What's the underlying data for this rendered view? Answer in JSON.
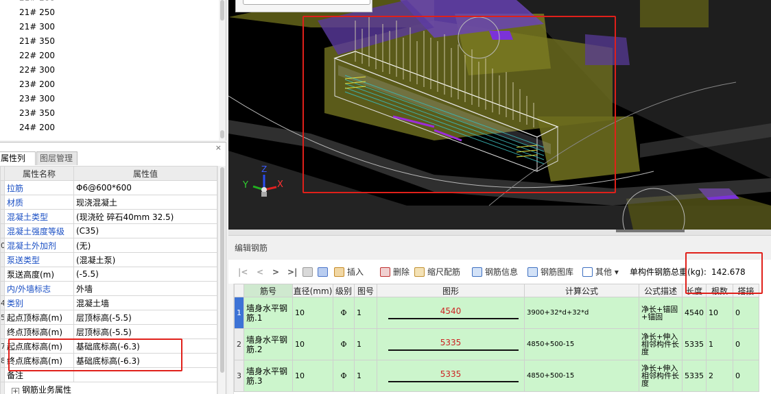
{
  "tree": {
    "items": [
      "21# 250",
      "21# 300",
      "21# 350",
      "22# 200",
      "22# 300",
      "23# 200",
      "23# 300",
      "23# 350",
      "24# 200"
    ]
  },
  "props": {
    "close": "×",
    "tabs": [
      "属性列表",
      "图层管理"
    ],
    "columns": {
      "name": "属性名称",
      "value": "属性值"
    },
    "rows": [
      {
        "num": "",
        "name": "拉筋",
        "value": "Φ6@600*600",
        "blue": true
      },
      {
        "num": "",
        "name": "材质",
        "value": "现浇混凝土",
        "blue": true
      },
      {
        "num": "",
        "name": "混凝土类型",
        "value": "(现浇砼 碎石40mm 32.5)",
        "blue": true
      },
      {
        "num": "",
        "name": "混凝土强度等级",
        "value": "(C35)",
        "blue": true
      },
      {
        "num": "0",
        "name": "混凝土外加剂",
        "value": "(无)",
        "blue": true
      },
      {
        "num": "",
        "name": "泵送类型",
        "value": "(混凝土泵)",
        "blue": true
      },
      {
        "num": "",
        "name": "泵送高度(m)",
        "value": "(-5.5)",
        "blue": false
      },
      {
        "num": "",
        "name": "内/外墙标志",
        "value": "外墙",
        "blue": true
      },
      {
        "num": "4",
        "name": "类别",
        "value": "混凝土墙",
        "blue": true
      },
      {
        "num": "5",
        "name": "起点顶标高(m)",
        "value": "层顶标高(-5.5)",
        "blue": false
      },
      {
        "num": "",
        "name": "终点顶标高(m)",
        "value": "层顶标高(-5.5)",
        "blue": false
      },
      {
        "num": "7",
        "name": "起点底标高(m)",
        "value": "基础底标高(-6.3)",
        "blue": false
      },
      {
        "num": "8",
        "name": "终点底标高(m)",
        "value": "基础底标高(-6.3)",
        "blue": false
      },
      {
        "num": "",
        "name": "备注",
        "value": "",
        "blue": false
      }
    ],
    "group": "钢筋业务属性",
    "group_plus": "+"
  },
  "viewport": {
    "axis_x": "X",
    "axis_y": "Y",
    "axis_z": "Z",
    "colors": {
      "background": "#000000",
      "olive": "#6b6b1e",
      "purple": "#6a45b5",
      "rebar": "#d8d2b0"
    }
  },
  "editor": {
    "title": "编辑钢筋",
    "toolbar": {
      "first": "|<",
      "prev": "<",
      "next": ">",
      "last": ">|",
      "insert": "插入",
      "delete": "删除",
      "scale": "缩尺配筋",
      "info": "钢筋信息",
      "library": "钢筋图库",
      "other": "其他",
      "other_arrow": "▾",
      "total_label": "单构件钢筋总重(kg):",
      "total_value": "142.678"
    },
    "columns": [
      "筋号",
      "直径(mm)",
      "级别",
      "图号",
      "图形",
      "计算公式",
      "公式描述",
      "长度",
      "根数",
      "搭接"
    ],
    "rows": [
      {
        "no": "1",
        "name": "墙身水平钢筋.1",
        "diameter": "10",
        "grade": "Φ",
        "figure": "1",
        "shape_len": "4540",
        "formula": "3900+32*d+32*d",
        "desc": "净长+锚固+锚固",
        "length": "4540",
        "count": "10",
        "lap": "0"
      },
      {
        "no": "2",
        "name": "墙身水平钢筋.2",
        "diameter": "10",
        "grade": "Φ",
        "figure": "1",
        "shape_len": "5335",
        "formula": "4850+500-15",
        "desc": "净长+伸入相邻构件长度",
        "length": "5335",
        "count": "1",
        "lap": "0"
      },
      {
        "no": "3",
        "name": "墙身水平钢筋.3",
        "diameter": "10",
        "grade": "Φ",
        "figure": "1",
        "shape_len": "5335",
        "formula": "4850+500-15",
        "desc": "净长+伸入相邻构件长度",
        "length": "5335",
        "count": "2",
        "lap": "0"
      }
    ]
  }
}
